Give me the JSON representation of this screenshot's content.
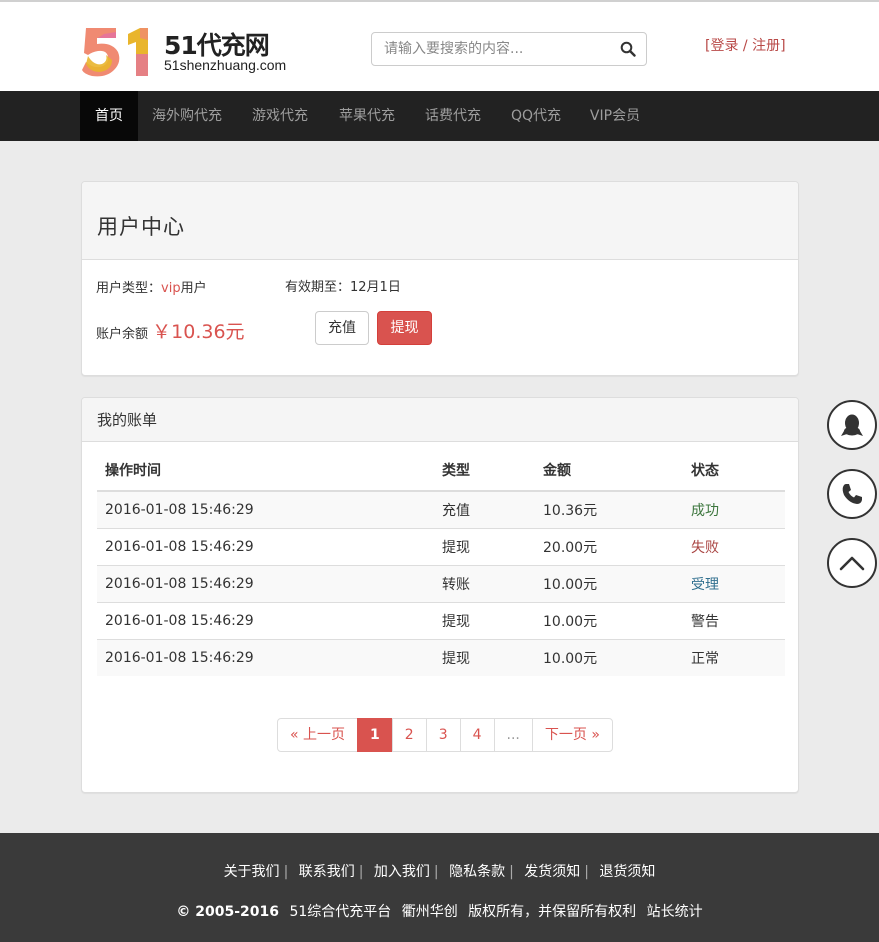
{
  "logo": {
    "mark": "51",
    "title": "51代充网",
    "domain": "51shenzhuang.com"
  },
  "search": {
    "placeholder": "请输入要搜索的内容..."
  },
  "auth": {
    "login": "登录",
    "separator": "/",
    "register": "注册"
  },
  "nav": {
    "items": [
      "首页",
      "海外购代充",
      "游戏代充",
      "苹果代充",
      "话费代充",
      "QQ代充",
      "VIP会员"
    ],
    "active": "首页"
  },
  "user_center": {
    "title": "用户中心",
    "user_type_label": "用户类型：",
    "user_type_vip": "vip",
    "user_type_suffix": "用户",
    "expire_label": "有效期至：",
    "expire_value": "12月1日",
    "balance_label": "账户余额",
    "balance_value": "￥10.36元",
    "recharge_button": "充值",
    "withdraw_button": "提现"
  },
  "bill": {
    "title": "我的账单",
    "columns": [
      "操作时间",
      "类型",
      "金额",
      "状态"
    ],
    "rows": [
      {
        "time": "2016-01-08 15:46:29",
        "type": "充值",
        "amount": "10.36元",
        "status": "成功"
      },
      {
        "time": "2016-01-08 15:46:29",
        "type": "提现",
        "amount": "20.00元",
        "status": "失败"
      },
      {
        "time": "2016-01-08 15:46:29",
        "type": "转账",
        "amount": "10.00元",
        "status": "受理"
      },
      {
        "time": "2016-01-08 15:46:29",
        "type": "提现",
        "amount": "10.00元",
        "status": "警告"
      },
      {
        "time": "2016-01-08 15:46:29",
        "type": "提现",
        "amount": "10.00元",
        "status": "正常"
      }
    ],
    "pagination": {
      "prev": "« 上一页",
      "pages": [
        "1",
        "2",
        "3",
        "4"
      ],
      "ellipsis": "...",
      "next": "下一页 »",
      "current": "1"
    }
  },
  "float_buttons": {
    "qq": "qq-icon",
    "phone": "phone-icon",
    "top": "chevron-up-icon"
  },
  "footer": {
    "links": [
      "关于我们",
      "联系我们",
      "加入我们",
      "隐私条款",
      "发货须知",
      "退货须知"
    ],
    "copyright": "© 2005-2016",
    "company": "51综合代充平台",
    "location": "衢州华创",
    "rights": "版权所有，并保留所有权利",
    "stats": "站长统计"
  },
  "colors": {
    "accent": "#d9534f",
    "navbar": "#222222",
    "footer": "#3a3a3a"
  }
}
